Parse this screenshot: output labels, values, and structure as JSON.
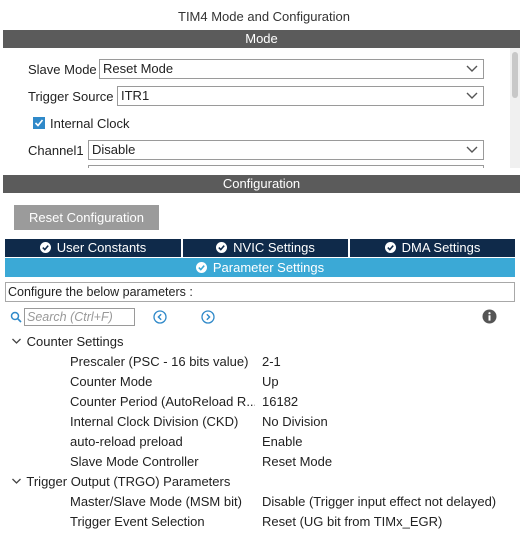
{
  "window": {
    "title": "TIM4 Mode and Configuration"
  },
  "mode": {
    "header": "Mode",
    "slave_mode": {
      "label": "Slave Mode",
      "value": "Reset Mode"
    },
    "trigger_source": {
      "label": "Trigger Source",
      "value": "ITR1"
    },
    "internal_clock": {
      "label": "Internal Clock",
      "checked": true
    },
    "channel1": {
      "label": "Channel1",
      "value": "Disable"
    }
  },
  "configuration": {
    "header": "Configuration",
    "reset_button": "Reset Configuration",
    "tabs": [
      {
        "label": "User Constants"
      },
      {
        "label": "NVIC Settings"
      },
      {
        "label": "DMA Settings"
      },
      {
        "label": "Parameter Settings",
        "active": true
      }
    ],
    "description": "Configure the below parameters :",
    "search": {
      "placeholder": "Search (Ctrl+F)"
    },
    "groups": [
      {
        "name": "Counter Settings",
        "params": [
          {
            "name": "Prescaler (PSC - 16 bits value)",
            "value": "2-1"
          },
          {
            "name": "Counter Mode",
            "value": "Up"
          },
          {
            "name": "Counter Period (AutoReload R...",
            "value": "16182"
          },
          {
            "name": "Internal Clock Division (CKD)",
            "value": "No Division"
          },
          {
            "name": "auto-reload preload",
            "value": "Enable"
          },
          {
            "name": "Slave Mode Controller",
            "value": "Reset Mode"
          }
        ]
      },
      {
        "name": "Trigger Output (TRGO) Parameters",
        "params": [
          {
            "name": "Master/Slave Mode (MSM bit)",
            "value": "Disable (Trigger input effect not delayed)"
          },
          {
            "name": "Trigger Event Selection",
            "value": "Reset (UG bit from TIMx_EGR)"
          }
        ]
      }
    ]
  },
  "colors": {
    "section_bar": "#5b5b5b",
    "tab_dark": "#0f2a4a",
    "tab_active": "#3ba9d6",
    "button_gray": "#9b9b9b",
    "accent_blue": "#2f89c9"
  },
  "icons": [
    "checkbox-checked-icon",
    "chevron-down-icon",
    "check-circle-icon",
    "search-icon",
    "arrow-left-circle-icon",
    "arrow-right-circle-icon",
    "info-icon",
    "collapse-arrow-icon"
  ]
}
